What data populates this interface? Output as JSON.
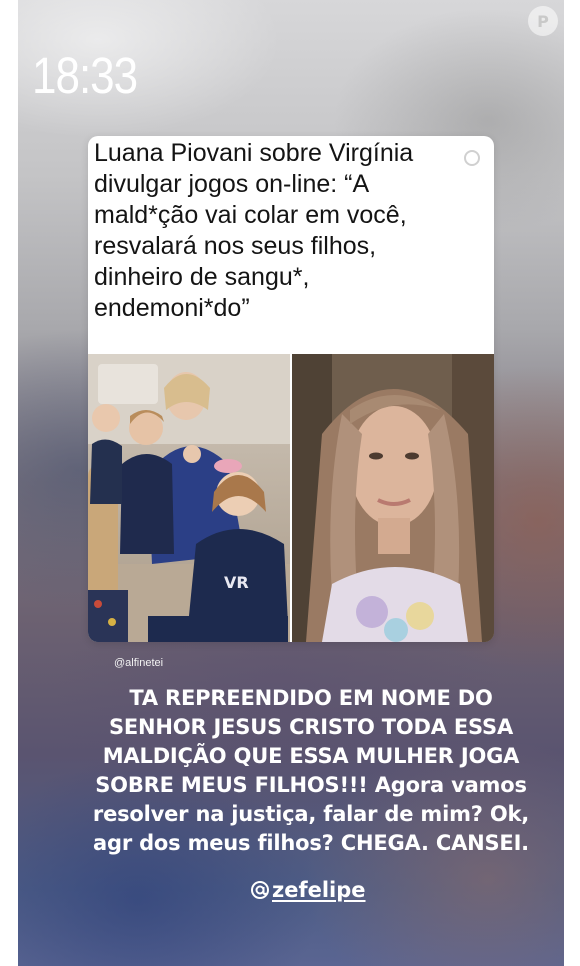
{
  "status_bar": {
    "time": "18:33"
  },
  "watermark": {
    "letter": "P"
  },
  "post": {
    "headline": "Luana Piovani sobre Virgínia\ndivulgar jogos on-line: “A\nmald*ção vai colar em você,\nresvalará nos seus filhos,\ndinheiro de sangu*,\nendemoni*do”",
    "source_handle": "@alfinetei",
    "left_photo_icon": "family-photo",
    "right_photo_icon": "portrait-photo"
  },
  "caption": {
    "text": "TA REPREENDIDO EM NOME DO\nSENHOR JESUS CRISTO TODA ESSA\nMALDIÇÃO QUE ESSA MULHER JOGA\nSOBRE MEUS FILHOS!!! Agora vamos\nresolver na justiça, falar de mim? Ok,\nagr dos meus filhos? CHEGA. CANSEI."
  },
  "mention": {
    "username": "zefelipe",
    "icon": "mention-at-icon"
  }
}
